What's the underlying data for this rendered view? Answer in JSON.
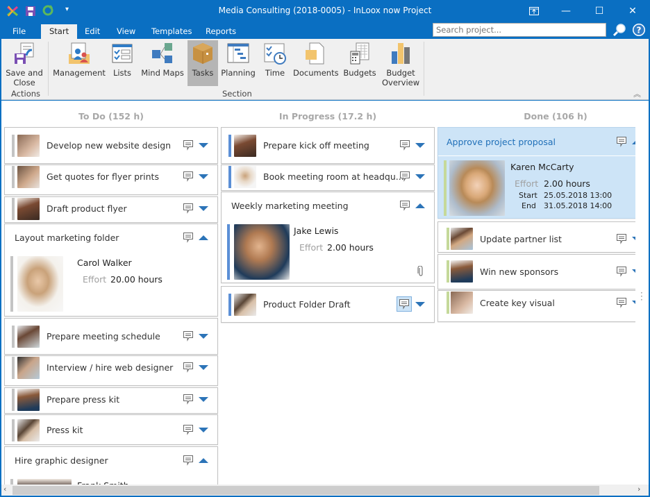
{
  "window": {
    "title": "Media Consulting (2018-0005) - InLoox now Project",
    "controls": [
      "restore-ribbon",
      "minimize",
      "maximize",
      "close"
    ]
  },
  "menu_tabs": [
    {
      "label": "File",
      "active": false
    },
    {
      "label": "Start",
      "active": true
    },
    {
      "label": "Edit",
      "active": false
    },
    {
      "label": "View",
      "active": false
    },
    {
      "label": "Templates",
      "active": false
    },
    {
      "label": "Reports",
      "active": false
    }
  ],
  "search": {
    "placeholder": "Search project..."
  },
  "ribbon": {
    "groups": [
      {
        "label": "Actions"
      },
      {
        "label": "Section"
      }
    ],
    "buttons": [
      {
        "label1": "Save and",
        "label2": "Close",
        "icon": "save-close-icon"
      },
      {
        "label1": "Management",
        "label2": "",
        "icon": "management-icon"
      },
      {
        "label1": "Lists",
        "label2": "",
        "icon": "lists-icon"
      },
      {
        "label1": "Mind Maps",
        "label2": "",
        "icon": "mind-maps-icon"
      },
      {
        "label1": "Tasks",
        "label2": "",
        "icon": "tasks-icon",
        "selected": true
      },
      {
        "label1": "Planning",
        "label2": "",
        "icon": "planning-icon"
      },
      {
        "label1": "Time",
        "label2": "",
        "icon": "time-icon"
      },
      {
        "label1": "Documents",
        "label2": "",
        "icon": "documents-icon"
      },
      {
        "label1": "Budgets",
        "label2": "",
        "icon": "budgets-icon"
      },
      {
        "label1": "Budget",
        "label2": "Overview",
        "icon": "budget-overview-icon"
      }
    ]
  },
  "colors": {
    "todo_bar": "#c4c4c4",
    "inprogress_bar": "#5b8fd6",
    "done_bar": "#c5d99a",
    "accent": "#0a6fc2",
    "highlight": "#cde4f7"
  },
  "columns": [
    {
      "title": "To Do (152 h)",
      "cards": [
        {
          "title": "Develop new website design",
          "expanded": false
        },
        {
          "title": "Get quotes for flyer prints",
          "expanded": false
        },
        {
          "title": "Draft product flyer",
          "expanded": false
        },
        {
          "title": "Layout marketing folder",
          "expanded": true,
          "person": "Carol Walker",
          "effort_label": "Effort",
          "effort": "20.00 hours"
        },
        {
          "title": "Prepare meeting schedule",
          "expanded": false
        },
        {
          "title": "Interview / hire web designer",
          "expanded": false
        },
        {
          "title": "Prepare press kit",
          "expanded": false
        },
        {
          "title": "Press kit",
          "expanded": false
        },
        {
          "title": "Hire graphic designer",
          "expanded": true,
          "person": "Frank Smith"
        }
      ]
    },
    {
      "title": "In Progress (17.2 h)",
      "cards": [
        {
          "title": "Prepare kick off meeting",
          "expanded": false
        },
        {
          "title": "Book meeting room at headqu...",
          "expanded": false
        },
        {
          "title": "Weekly marketing meeting",
          "expanded": true,
          "person": "Jake Lewis",
          "effort_label": "Effort",
          "effort": "2.00 hours",
          "attachment": true
        },
        {
          "title": "Product Folder Draft",
          "expanded": false,
          "comment_active": true
        }
      ]
    },
    {
      "title": "Done (106 h)",
      "cards": [
        {
          "title": "Approve project proposal",
          "expanded": true,
          "selected": true,
          "person": "Karen McCarty",
          "effort_label": "Effort",
          "effort": "2.00 hours",
          "start_label": "Start",
          "start": "25.05.2018 13:00",
          "end_label": "End",
          "end": "31.05.2018 14:00"
        },
        {
          "title": "Update partner list",
          "expanded": false
        },
        {
          "title": "Win new sponsors",
          "expanded": false
        },
        {
          "title": "Create key visual",
          "expanded": false
        }
      ]
    }
  ]
}
